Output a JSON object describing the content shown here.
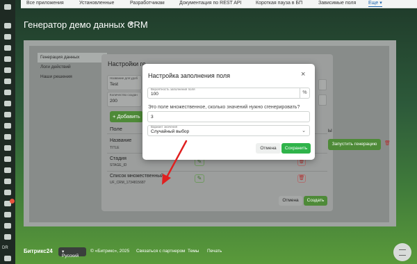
{
  "top_tabs": [
    "Все приложения",
    "Установленные",
    "Разработчикам",
    "Документация по REST API",
    "Короткая пауза в БП",
    "Зависимые поля",
    "Еще"
  ],
  "page_title": "Генератор демо данных CRM",
  "left_menu": [
    "Генерация данных",
    "Логи действий",
    "Наши решения"
  ],
  "main_dialog": {
    "title": "Настройки ге",
    "field1_label": "Название для удоб",
    "field1_value": "Test",
    "field2_label": "Количество создан",
    "field2_value": "200",
    "add_button": "+ Добавить",
    "col_field": "Поле",
    "rows": [
      {
        "name": "Название",
        "code": "TITLE"
      },
      {
        "name": "Стадия",
        "code": "STAGE_ID"
      },
      {
        "name": "Список множественный",
        "code": "UF_CRM_1734815687"
      }
    ],
    "cancel": "Отмена",
    "create": "Создать"
  },
  "run_button": "Запустить генерацию",
  "fill_dialog": {
    "title": "Настройка заполнения поля",
    "prob_label": "Вероятность заполнения поля",
    "prob_value": "100",
    "prob_unit": "%",
    "multi_question": "Это поле множественное, сколько значений нужно сгенерировать?",
    "multi_value": "3",
    "variant_label": "Вариант значения",
    "variant_value": "Случайный выбор",
    "cancel": "Отмена",
    "save": "Сохранить"
  },
  "footer": {
    "logo": "Битрикс24",
    "language": "Русский",
    "copyright": "© «Битрикс», 2025",
    "partner": "Связаться с партнером",
    "themes": "Темы",
    "print": "Печать"
  },
  "colors": {
    "accent_green": "#2fb34a",
    "arrow_red": "#e02020"
  }
}
